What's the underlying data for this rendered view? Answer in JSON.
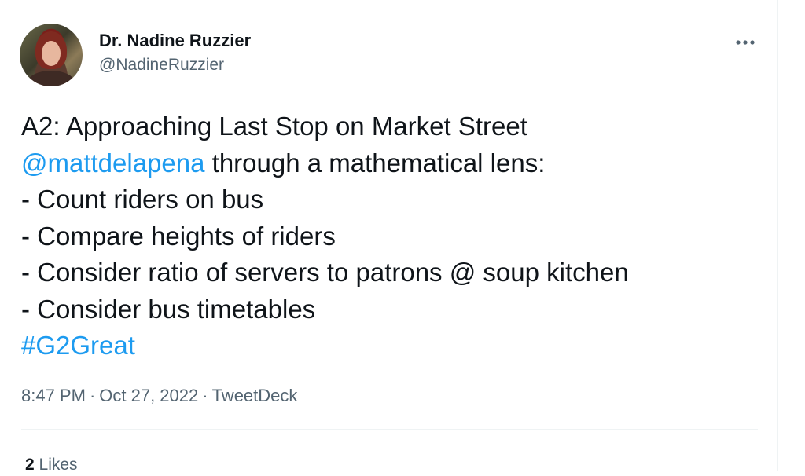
{
  "author": {
    "display_name": "Dr. Nadine Ruzzier",
    "handle": "@NadineRuzzier",
    "avatar_icon": "profile-photo"
  },
  "more_icon": "more-horizontal-icon",
  "tweet": {
    "line1": "A2:  Approaching Last Stop on Market Street",
    "mention": "@mattdelapena",
    "line2_rest": " through a mathematical lens:",
    "line3": "- Count riders on bus",
    "line4": "- Compare heights of riders",
    "line5": "- Consider ratio of servers to patrons @ soup kitchen",
    "line6": "- Consider bus timetables",
    "hashtag": "#G2Great"
  },
  "meta": {
    "time": "8:47 PM",
    "date": "Oct 27, 2022",
    "source": "TweetDeck",
    "separator": "·"
  },
  "stats": {
    "likes_count": "2",
    "likes_label": "Likes"
  },
  "colors": {
    "link": "#1d9bf0",
    "secondary_text": "#536471",
    "primary_text": "#0f1419"
  }
}
